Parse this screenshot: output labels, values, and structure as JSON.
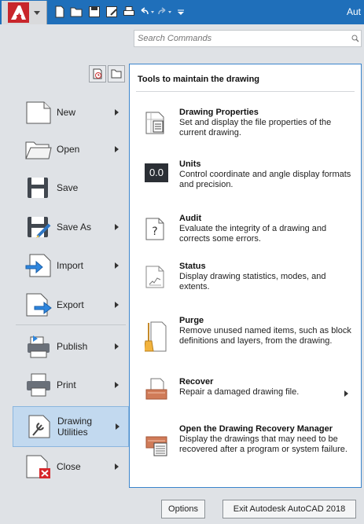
{
  "titlebar": {
    "title_text": "Aut"
  },
  "search": {
    "placeholder": "Search Commands"
  },
  "left_menu": [
    {
      "label": "New",
      "icon": "new-file-icon",
      "has_submenu": true
    },
    {
      "label": "Open",
      "icon": "open-folder-icon",
      "has_submenu": true
    },
    {
      "label": "Save",
      "icon": "save-disk-icon",
      "has_submenu": false
    },
    {
      "label": "Save As",
      "icon": "save-as-icon",
      "has_submenu": true
    },
    {
      "label": "Import",
      "icon": "import-icon",
      "has_submenu": true
    },
    {
      "label": "Export",
      "icon": "export-icon",
      "has_submenu": true
    },
    {
      "label": "Publish",
      "icon": "publish-icon",
      "has_submenu": true
    },
    {
      "label": "Print",
      "icon": "printer-icon",
      "has_submenu": true
    },
    {
      "label": "Drawing Utilities",
      "label_line1": "Drawing",
      "label_line2": "Utilities",
      "icon": "drawing-utilities-icon",
      "has_submenu": true,
      "active": true
    },
    {
      "label": "Close",
      "icon": "close-file-icon",
      "has_submenu": true
    }
  ],
  "panel": {
    "header": "Tools to maintain the drawing",
    "tools": [
      {
        "title": "Drawing Properties",
        "description": "Set and display the file properties of the current drawing.",
        "icon": "drawing-properties-icon"
      },
      {
        "title": "Units",
        "description": "Control coordinate and angle display formats and precision.",
        "icon": "units-icon",
        "icon_text": "0.0"
      },
      {
        "title": "Audit",
        "description": "Evaluate the integrity of a drawing and corrects some errors.",
        "icon": "audit-icon",
        "icon_text": "?"
      },
      {
        "title": "Status",
        "description": "Display drawing statistics, modes, and extents.",
        "icon": "status-icon"
      },
      {
        "title": "Purge",
        "description": "Remove unused named items, such as block definitions and layers, from the drawing.",
        "icon": "purge-icon"
      },
      {
        "title": "Recover",
        "description": "Repair a damaged drawing file.",
        "icon": "recover-icon",
        "has_submenu": true
      },
      {
        "title": "Open the Drawing Recovery Manager",
        "description": "Display the drawings that may need to be recovered after a program or system failure.",
        "icon": "recovery-manager-icon"
      }
    ]
  },
  "buttons": {
    "options": "Options",
    "exit": "Exit Autodesk AutoCAD 2018"
  },
  "colors": {
    "titlebar": "#1f6fba",
    "panel_border": "#3a84cc",
    "active_item": "#c2d9ef",
    "logo_red": "#c8262c"
  }
}
